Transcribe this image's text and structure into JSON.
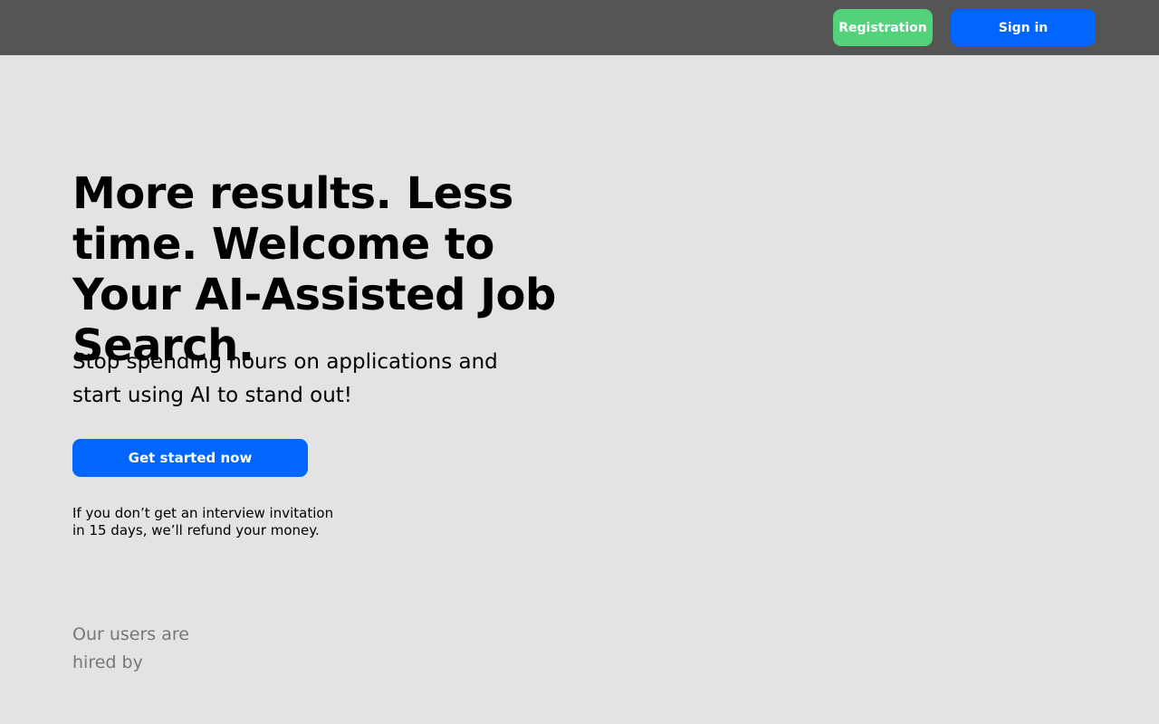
{
  "header": {
    "registration_label": "Registration",
    "signin_label": "Sign in"
  },
  "hero": {
    "title": "More results. Less time. Welcome to Your AI-Assisted Job Search.",
    "subtitle": "Stop spending hours on applications and start using AI to stand out!",
    "cta_label": "Get started now",
    "refund_note": "If you don’t get an interview invitation in 15 days, we’ll refund your money."
  },
  "social_proof": {
    "label": "Our users are hired by"
  },
  "colors": {
    "topbar": "#555555",
    "background": "#e3e3e3",
    "primary": "#0066ff",
    "registration": "#52d27a",
    "muted_text": "#777777"
  }
}
